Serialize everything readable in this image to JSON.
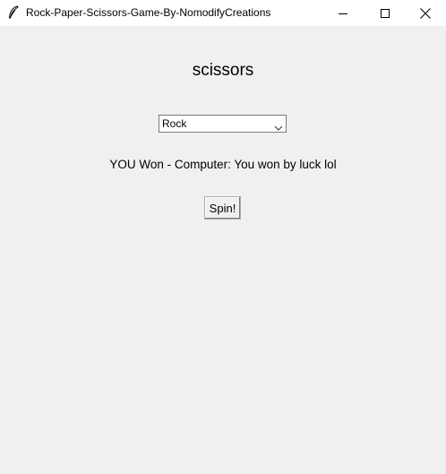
{
  "window": {
    "title": "Rock-Paper-Scissors-Game-By-NomodifyCreations",
    "icon": "feather-icon",
    "controls": [
      "minimize-icon",
      "maximize-icon",
      "close-icon"
    ]
  },
  "game": {
    "computer_choice": "scissors",
    "player_select": {
      "value": "Rock"
    },
    "result": "YOU Won -  Computer: You won by luck lol",
    "spin_label": "Spin!"
  },
  "colors": {
    "background": "#f0f0f0",
    "titlebar": "#ffffff",
    "text": "#000000"
  }
}
